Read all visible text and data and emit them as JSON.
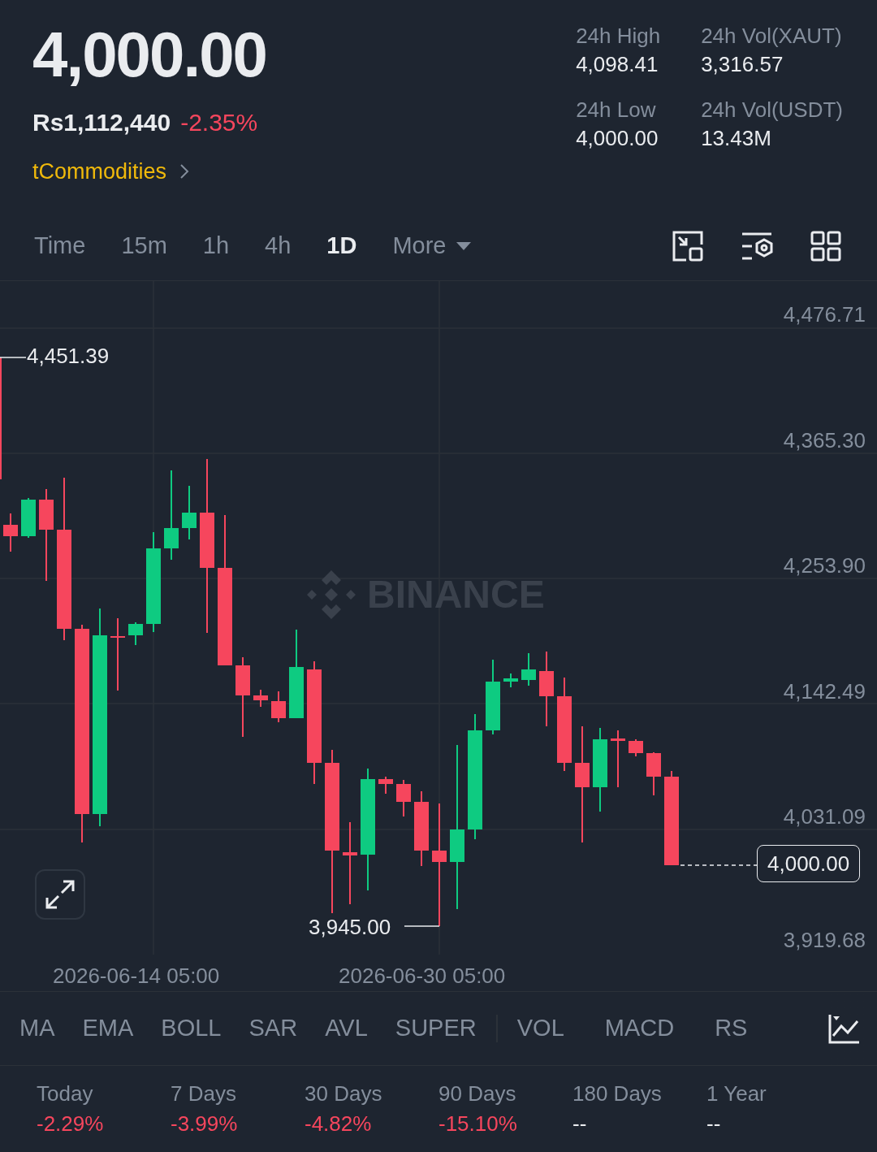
{
  "header": {
    "price": "4,000.00",
    "fiat_price": "Rs1,112,440",
    "change": "-2.35%",
    "category": "tCommodities"
  },
  "stats": [
    {
      "label": "24h High",
      "value": "4,098.41"
    },
    {
      "label": "24h Vol(XAUT)",
      "value": "3,316.57"
    },
    {
      "label": "24h Low",
      "value": "4,000.00"
    },
    {
      "label": "24h Vol(USDT)",
      "value": "13.43M"
    }
  ],
  "intervals": [
    {
      "label": "Time",
      "selected": false
    },
    {
      "label": "15m",
      "selected": false
    },
    {
      "label": "1h",
      "selected": false
    },
    {
      "label": "4h",
      "selected": false
    },
    {
      "label": "1D",
      "selected": true
    },
    {
      "label": "More",
      "selected": false
    }
  ],
  "chart": {
    "watermark": "BINANCE",
    "y_axis": [
      "4,476.71",
      "4,365.30",
      "4,253.90",
      "4,142.49",
      "4,031.09",
      "3,919.68"
    ],
    "x_axis": [
      "2026-06-14 05:00",
      "2026-06-30 05:00"
    ],
    "high_marker": "4,451.39",
    "low_marker": "3,945.00",
    "last_price": "4,000.00"
  },
  "main_indicators": [
    "MA",
    "EMA",
    "BOLL",
    "SAR",
    "AVL",
    "SUPER"
  ],
  "sub_indicators": [
    "VOL",
    "MACD",
    "RS"
  ],
  "performance": [
    {
      "period": "Today",
      "change": "-2.29%",
      "color": "#f6465d"
    },
    {
      "period": "7 Days",
      "change": "-3.99%",
      "color": "#f6465d"
    },
    {
      "period": "30 Days",
      "change": "-4.82%",
      "color": "#f6465d"
    },
    {
      "period": "90 Days",
      "change": "-15.10%",
      "color": "#f6465d"
    },
    {
      "period": "180 Days",
      "change": "--",
      "color": "#eaecef"
    },
    {
      "period": "1 Year",
      "change": "--",
      "color": "#eaecef"
    }
  ]
}
